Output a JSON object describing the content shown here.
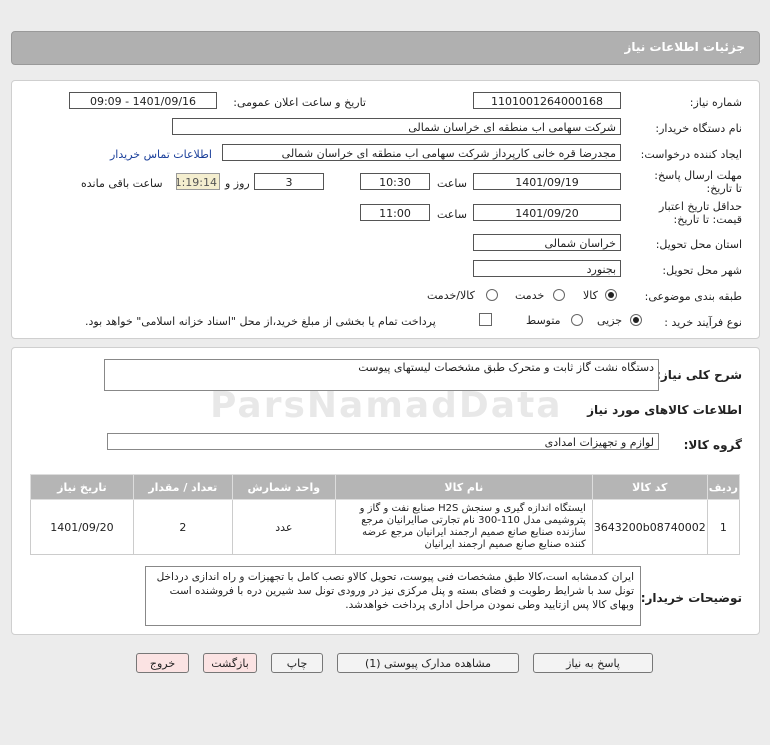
{
  "header": {
    "title": "جزئیات اطلاعات نیاز"
  },
  "info": {
    "need_number_label": "شماره نیاز:",
    "need_number": "1101001264000168",
    "announce_label": "تاریخ و ساعت اعلان عمومی:",
    "announce_value": "1401/09/16 - 09:09",
    "buyer_label": "نام دستگاه خریدار:",
    "buyer": "شرکت سهامی اب منطقه ای خراسان شمالی",
    "creator_label": "ایجاد کننده درخواست:",
    "creator": "مجدرضا قره خانی کارپرداز شرکت سهامی اب منطقه ای خراسان شمالی",
    "contact_link": "اطلاعات تماس خریدار",
    "deadline_label": "مهلت ارسال پاسخ: تا تاریخ:",
    "deadline_date": "1401/09/19",
    "time_label": "ساعت",
    "deadline_time": "10:30",
    "days_value": "3",
    "days_label": "روز و",
    "remaining": "01:19:14",
    "remaining_label": "ساعت باقی مانده",
    "validity_label": "حداقل تاریخ اعتبار قیمت: تا تاریخ:",
    "validity_date": "1401/09/20",
    "validity_time": "11:00",
    "province_label": "استان محل تحویل:",
    "province": "خراسان شمالی",
    "city_label": "شهر محل تحویل:",
    "city": "بجنورد",
    "category_label": "طبقه بندی موضوعی:",
    "category_options": [
      "کالا",
      "خدمت",
      "کالا/خدمت"
    ],
    "process_label": "نوع فرآیند خرید :",
    "process_options": [
      "جزیی",
      "متوسط"
    ],
    "process_note": "پرداخت تمام یا بخشی از مبلغ خرید،از محل \"اسناد خزانه اسلامی\" خواهد بود."
  },
  "desc": {
    "label": "شرح کلی نیاز:",
    "value": "دستگاه نشت گاز ثابت و متحرک طبق مشخصات لیستهای پیوست",
    "goods_title": "اطلاعات کالاهای مورد نیاز",
    "group_label": "گروه کالا:",
    "group_value": "لوازم و تجهیزات امدادی"
  },
  "table": {
    "headers": [
      "ردیف",
      "کد کالا",
      "نام کالا",
      "واحد شمارش",
      "تعداد / مقدار",
      "تاریخ نیاز"
    ],
    "rows": [
      {
        "row": "1",
        "code": "3643200b08740002",
        "name": "ایستگاه اندازه گیری و سنجش H2S صنایع نفت و گاز و پتروشیمی مدل 110-300 نام تجارتی صاایرانیان مرجع سازنده صنایع صانع صمیم ارجمند ایرانیان مرجع عرضه کننده صنایع صانع صمیم ارجمند ایرانیان",
        "unit": "عدد",
        "qty": "2",
        "date": "1401/09/20"
      }
    ]
  },
  "buyer_notes": {
    "label": "توضیحات خریدار:",
    "value": "ایران کدمشابه است،کالا طبق مشخصات فنی پیوست، تحویل کالاو نصب کامل با تجهیزات و راه اندازی درداخل تونل سد با شرایط رطوبت و فضای بسته و پنل مرکزی نیز در ورودی تونل سد شیرین دره با فروشنده است وبهای کالا پس ازتایید وطی نمودن مراحل اداری پرداخت خواهدشد."
  },
  "buttons": {
    "reply": "پاسخ به نیاز",
    "attachments": "مشاهده مدارک پیوستی (1)",
    "print": "چاپ",
    "back": "بازگشت",
    "exit": "خروج"
  },
  "watermark": "ParsNamadData"
}
